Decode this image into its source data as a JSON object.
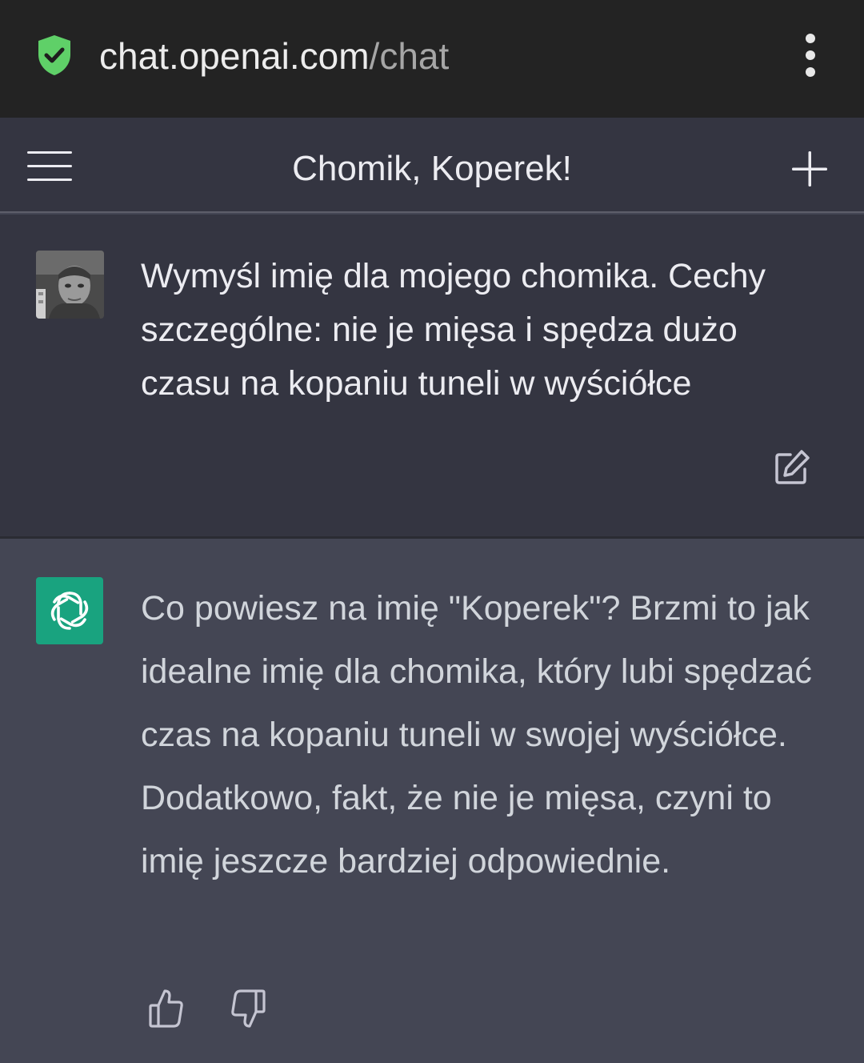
{
  "browser": {
    "url_host": "chat.openai.com",
    "url_path": "/chat",
    "icons": {
      "security": "shield-check-icon",
      "menu": "kebab-menu-icon"
    },
    "colors": {
      "shield": "#5fd068"
    }
  },
  "header": {
    "title": "Chomik, Koperek!",
    "icons": {
      "menu": "hamburger-menu-icon",
      "new_chat": "plus-icon"
    }
  },
  "conversation": {
    "user_message": {
      "text": "Wymyśl imię dla mojego chomika. Cechy szczególne: nie je mięsa i spędza dużo czasu na kopaniu tuneli w wyściółce",
      "avatar": "user-photo-avatar",
      "action_icon": "edit-icon"
    },
    "assistant_message": {
      "text": "Co powiesz na imię \"Koperek\"? Brzmi to jak idealne imię dla chomika, który lubi spędzać czas na kopaniu tuneli w swojej wyściółce. Dodatkowo, fakt, że nie je mięsa, czyni to imię jeszcze bardziej odpowiednie.",
      "avatar": "openai-logo-icon",
      "avatar_color": "#19a37f",
      "feedback_icons": [
        "thumbs-up-icon",
        "thumbs-down-icon"
      ]
    }
  },
  "theme": {
    "url_bar_bg": "#232323",
    "user_bg": "#343541",
    "assistant_bg": "#444654",
    "text_color": "#ececf1"
  }
}
